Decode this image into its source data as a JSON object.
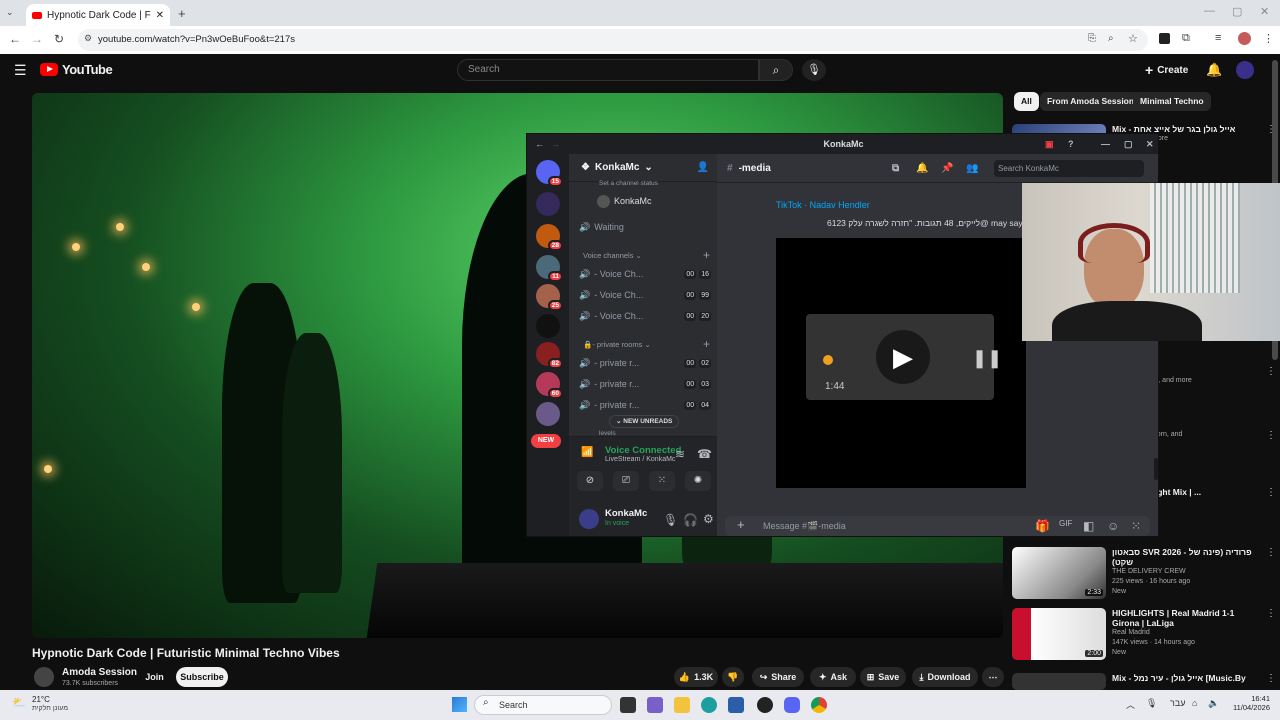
{
  "browser": {
    "tab_title": "Hypnotic Dark Code | Futuristi",
    "url": "youtube.com/watch?v=Pn3wOeBuFoo&t=217s"
  },
  "youtube": {
    "logo": "YouTube",
    "search_placeholder": "Search",
    "create_label": "Create",
    "notif_count": "",
    "chips": [
      "All",
      "From Amoda Session",
      "Minimal Techno"
    ],
    "video": {
      "title": "Hypnotic Dark Code | Futuristic Minimal Techno Vibes",
      "channel": "Amoda Session",
      "subscribers": "73.7K subscribers",
      "join": "Join",
      "subscribe": "Subscribe",
      "likes": "1.3K",
      "share": "Share",
      "ask": "Ask",
      "save": "Save",
      "download": "Download"
    },
    "recommendations": [
      {
        "title": "Mix - אייל גולן בגר של אייצ אחת",
        "meta": "Aharon, and more",
        "new": "",
        "duration": ""
      },
      {
        "title": "ic music",
        "meta": "anxo, NOTION, and more",
        "new": "",
        "duration": ""
      },
      {
        "title": "",
        "meta": "Cohen, Pete Yorn, and",
        "new": "",
        "duration": ""
      },
      {
        "title": "Techno | Night Mix | ...",
        "meta": "ays ago",
        "new": "New",
        "duration": ""
      },
      {
        "title": "סבאטון SVR 2026 - פרודיה (פינה של שקט)",
        "meta": "THE DELIVERY CREW",
        "meta2": "225 views · 16 hours ago",
        "new": "New",
        "duration": "2:33"
      },
      {
        "title": "HIGHLIGHTS | Real Madrid 1-1 Girona | LaLiga",
        "meta": "Real Madrid",
        "meta2": "147K views · 14 hours ago",
        "new": "New",
        "duration": "2:00"
      },
      {
        "title": "Mix - אייל גולן - עיר נמל [Music.By",
        "meta": "",
        "new": "",
        "duration": ""
      }
    ]
  },
  "discord": {
    "window_title": "KonkaMc",
    "server_name": "KonkaMc",
    "server_badges": [
      "15",
      "",
      "28",
      "11",
      "25",
      "",
      "82",
      "60",
      ""
    ],
    "new_label": "NEW",
    "set_status": "Set a channel status",
    "voice_user": "KonkaMc",
    "waiting_channel": "Waiting",
    "voice_category": "Voice channels",
    "voice_channels": [
      {
        "name": "- Voice Ch...",
        "a": "00",
        "b": "16"
      },
      {
        "name": "- Voice Ch...",
        "a": "00",
        "b": "99"
      },
      {
        "name": "- Voice Ch...",
        "a": "00",
        "b": "20"
      }
    ],
    "private_category": "- private rooms",
    "private_rooms": [
      {
        "name": "- private r...",
        "a": "00",
        "b": "02"
      },
      {
        "name": "- private r...",
        "a": "00",
        "b": "03"
      },
      {
        "name": "- private r...",
        "a": "00",
        "b": "04"
      }
    ],
    "new_unreads": "NEW UNREADS",
    "levels_label": "levels",
    "voice_connected": "Voice Connected",
    "voice_location": "LiveStream / KonkaMc",
    "user_name": "KonkaMc",
    "user_status": "In voice",
    "channel_name": "-media",
    "search_placeholder": "Search KonkaMc",
    "embed_link": "TikTok · Nadav Hendler",
    "embed_desc": "6123 לייקים, 48 תגובות. \"חזרה לשגרה עלק@ may sayag\"",
    "embed_time": "1:44",
    "message_placeholder": "Message #🎬-media"
  },
  "taskbar": {
    "weather_temp": "21°C",
    "weather_desc": "מעונן חלקית",
    "search": "Search",
    "lang": "עבר",
    "time": "16:41",
    "date": "11/04/2026"
  }
}
